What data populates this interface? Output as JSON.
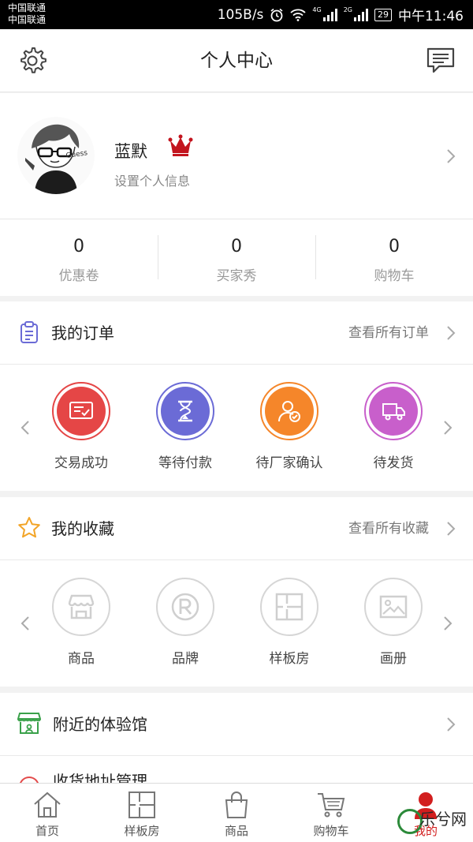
{
  "status_bar": {
    "carrier_1": "中国联通",
    "carrier_2": "中国联通",
    "speed": "105B/s",
    "net_1": "4G",
    "net_2": "2G",
    "battery": "29",
    "time": "中午11:46"
  },
  "header": {
    "title": "个人中心",
    "settings_icon": "gear-icon",
    "message_icon": "message-icon"
  },
  "profile": {
    "name": "蓝默",
    "subtitle": "设置个人信息",
    "badge_icon": "crown-icon",
    "badge_color": "#c3141e"
  },
  "stats": [
    {
      "value": "0",
      "label": "优惠卷"
    },
    {
      "value": "0",
      "label": "买家秀"
    },
    {
      "value": "0",
      "label": "购物车"
    }
  ],
  "orders": {
    "title": "我的订单",
    "more": "查看所有订单",
    "items": [
      {
        "label": "交易成功",
        "color": "#e54646",
        "icon": "receipt-check-icon"
      },
      {
        "label": "等待付款",
        "color": "#6b6bd6",
        "icon": "hourglass-icon"
      },
      {
        "label": "待厂家确认",
        "color": "#f5862a",
        "icon": "user-check-icon"
      },
      {
        "label": "待发货",
        "color": "#c85fcb",
        "icon": "delivery-truck-icon"
      }
    ]
  },
  "favorites": {
    "title": "我的收藏",
    "more": "查看所有收藏",
    "items": [
      {
        "label": "商品",
        "icon": "store-icon"
      },
      {
        "label": "品牌",
        "icon": "registered-icon"
      },
      {
        "label": "样板房",
        "icon": "floorplan-icon"
      },
      {
        "label": "画册",
        "icon": "picture-icon"
      }
    ]
  },
  "nearby": {
    "title": "附近的体验馆"
  },
  "partial_row": {
    "title": "收货地址管理"
  },
  "tabbar": [
    {
      "label": "首页",
      "icon": "home-icon"
    },
    {
      "label": "样板房",
      "icon": "floorplan-icon"
    },
    {
      "label": "商品",
      "icon": "shopping-bag-icon"
    },
    {
      "label": "购物车",
      "icon": "cart-icon"
    },
    {
      "label": "我的",
      "icon": "user-icon",
      "active": true
    }
  ],
  "watermark": "乐兮网"
}
